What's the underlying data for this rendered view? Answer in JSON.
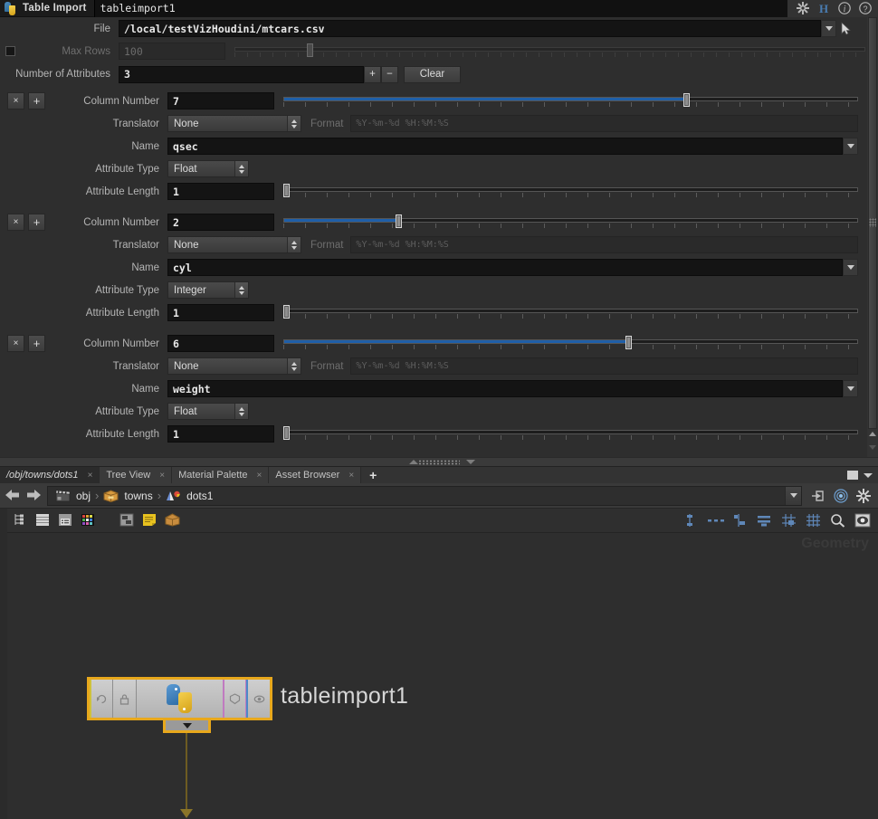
{
  "window": {
    "node_type": "Table Import",
    "node_name": "tableimport1",
    "icons": [
      "gear-icon",
      "houdini-h-icon",
      "info-icon",
      "help-icon"
    ]
  },
  "parameters": {
    "file": {
      "label": "File",
      "value": "/local/testVizHoudini/mtcars.csv"
    },
    "max_rows": {
      "label": "Max Rows",
      "value": "100",
      "enabled": false
    },
    "num_attributes": {
      "label": "Number of Attributes",
      "value": "3",
      "plus": "+",
      "minus": "−",
      "clear": "Clear"
    },
    "labels": {
      "column_number": "Column Number",
      "translator": "Translator",
      "format": "Format",
      "name": "Name",
      "attribute_type": "Attribute Type",
      "attribute_length": "Attribute Length"
    },
    "format_placeholder": "%Y-%m-%d  %H:%M:%S",
    "remove_btn": "×",
    "add_btn": "+",
    "attributes": [
      {
        "column_number": "7",
        "column_pct": 70,
        "translator": "None",
        "name": "qsec",
        "attribute_type": "Float",
        "attribute_length": "1",
        "length_pct": 0
      },
      {
        "column_number": "2",
        "column_pct": 20,
        "translator": "None",
        "name": "cyl",
        "attribute_type": "Integer",
        "attribute_length": "1",
        "length_pct": 0
      },
      {
        "column_number": "6",
        "column_pct": 60,
        "translator": "None",
        "name": "weight",
        "attribute_type": "Float",
        "attribute_length": "1",
        "length_pct": 0
      }
    ]
  },
  "tabs": [
    {
      "label": "/obj/towns/dots1",
      "active": true,
      "close": "×"
    },
    {
      "label": "Tree View",
      "active": false,
      "close": "×"
    },
    {
      "label": "Material Palette",
      "active": false,
      "close": "×"
    },
    {
      "label": "Asset Browser",
      "active": false,
      "close": "×"
    }
  ],
  "tab_add": "+",
  "breadcrumb": {
    "items": [
      {
        "label": "obj",
        "icon": "clapperboard-icon"
      },
      {
        "label": "towns",
        "icon": "box-icon"
      },
      {
        "label": "dots1",
        "icon": "geometry-icon"
      }
    ],
    "separator": "›",
    "right_icons": [
      "pin-icon",
      "target-icon",
      "gear-icon"
    ]
  },
  "network_toolbar": {
    "left_icons": [
      "tree-list-icon",
      "list-icon",
      "details-icon",
      "color-palette-icon",
      "layout-icon",
      "notes-icon",
      "box-icon"
    ],
    "right_icons": [
      "align-vertical-icon",
      "distribute-horizontal-icon",
      "align-left-icon",
      "align-rows-icon",
      "snap-grid-icon",
      "grid-icon",
      "search-icon",
      "display-icon"
    ]
  },
  "network_view": {
    "watermark": "Geometry",
    "node": {
      "name": "tableimport1",
      "icon": "python-icon",
      "flags": [
        "bypass-flag",
        "lock-flag",
        "template-flag",
        "display-flag"
      ],
      "selected": true,
      "flyout_icon": "chevron-down-icon"
    }
  },
  "colors": {
    "accent_blue": "#1f5fa8",
    "selection_orange": "#e8a81c",
    "wire": "#6e5c22",
    "panel_bg": "#2e2e2e",
    "field_bg": "#141414"
  }
}
